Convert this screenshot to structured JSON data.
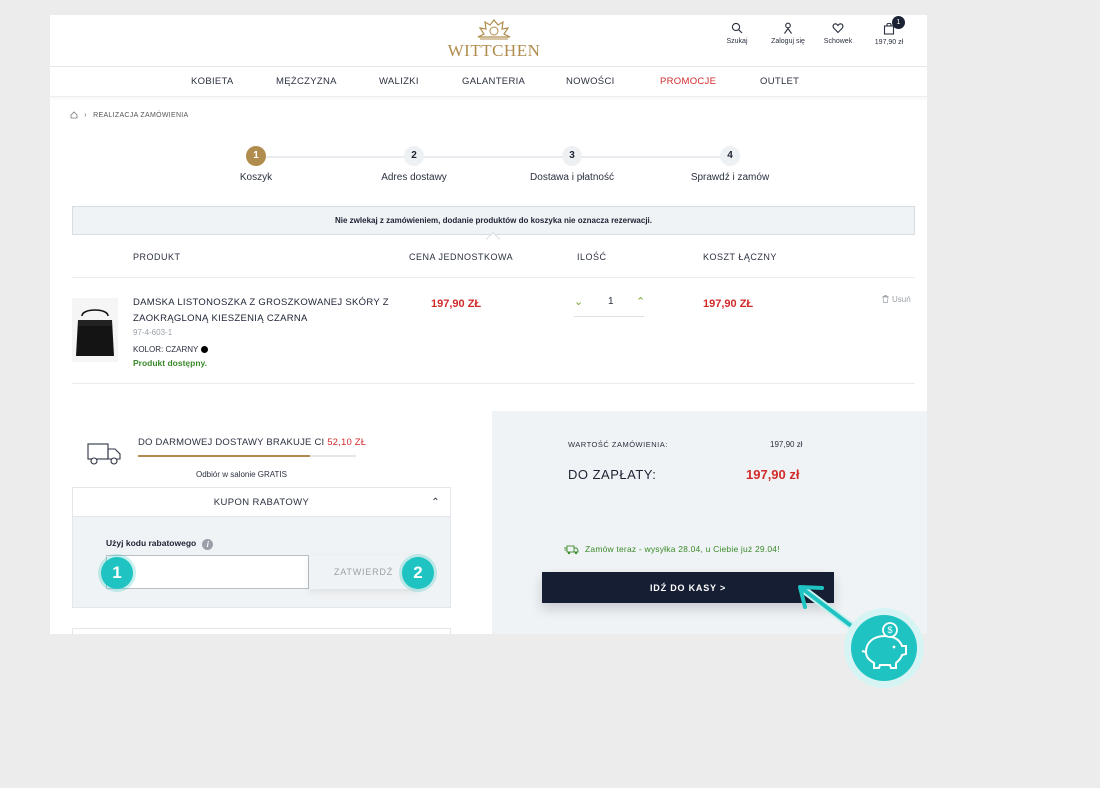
{
  "brand": "WITTCHEN",
  "header_icons": [
    {
      "label": "Szukaj",
      "icon": "search-icon"
    },
    {
      "label": "Zaloguj się",
      "icon": "user-icon"
    },
    {
      "label": "Schowek",
      "icon": "heart-icon"
    },
    {
      "label": "197,90 zł",
      "icon": "bag-icon",
      "badge": "1"
    }
  ],
  "nav": [
    "KOBIETA",
    "MĘŻCZYZNA",
    "WALIZKI",
    "GALANTERIA",
    "NOWOŚCI",
    "PROMOCJE",
    "OUTLET"
  ],
  "breadcrumb": "REALIZACJA ZAMÓWIENIA",
  "steps": [
    {
      "num": "1",
      "label": "Koszyk"
    },
    {
      "num": "2",
      "label": "Adres dostawy"
    },
    {
      "num": "3",
      "label": "Dostawa i płatność"
    },
    {
      "num": "4",
      "label": "Sprawdź i zamów"
    }
  ],
  "info": "Nie zwlekaj z zamówieniem, dodanie produktów do koszyka nie oznacza rezerwacji.",
  "table_headers": [
    "PRODUKT",
    "CENA JEDNOSTKOWA",
    "ILOŚĆ",
    "KOSZT ŁĄCZNY"
  ],
  "product": {
    "name": "DAMSKA LISTONOSZKA Z GROSZKOWANEJ SKÓRY Z ZAOKRĄGLONĄ KIESZENIĄ CZARNA",
    "sku": "97-4-603-1",
    "color": "KOLOR: CZARNY",
    "availability": "Produkt dostępny.",
    "unit_price": "197,90 ZŁ",
    "qty": "1",
    "total": "197,90 ZŁ",
    "remove": "Usuń"
  },
  "free_delivery": {
    "text": "DO DARMOWEJ DOSTAWY BRAKUJE CI ",
    "amount": "52,10 ZŁ",
    "progress": 0.79,
    "pickup": "Odbiór w salonie GRATIS"
  },
  "coupon": {
    "title": "KUPON RABATOWY",
    "label": "Użyj kodu rabatowego",
    "input_value": "",
    "button": "ZATWIERDŹ"
  },
  "summary": {
    "order_value_label": "WARTOŚĆ ZAMÓWIENIA:",
    "order_value": "197,90 zł",
    "to_pay_label": "DO ZAPŁATY:",
    "to_pay": "197,90 zł",
    "shipping_note": "Zamów teraz - wysyłka 28.04, u Ciebie już 29.04!",
    "checkout": "IDŹ DO KASY  >"
  },
  "overlay_badges": [
    "1",
    "2"
  ],
  "colors": {
    "accent_gold": "#b08d4e",
    "price_red": "#d12a2a",
    "navy": "#161e33",
    "teal": "#1fc3c1",
    "green": "#3a8a2a"
  }
}
